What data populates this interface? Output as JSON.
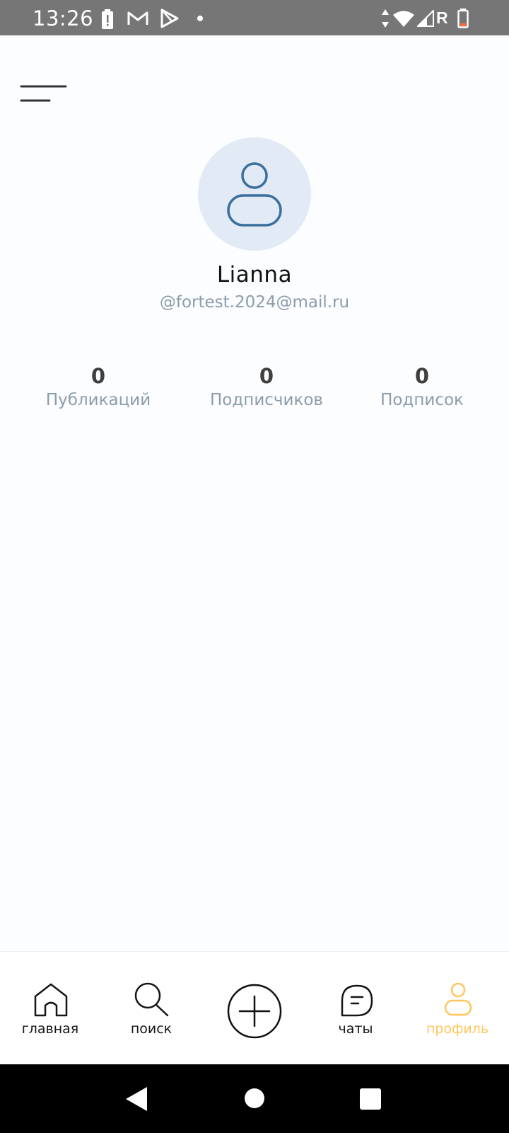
{
  "status_bar": {
    "time": "13:26",
    "icons": [
      "battery-alert-icon",
      "gmail-icon",
      "play-store-icon",
      "dot-icon",
      "data-arrows-icon",
      "wifi-icon",
      "signal-icon",
      "roaming-icon",
      "battery-icon"
    ],
    "roaming_label": "R"
  },
  "profile": {
    "name": "Lianna",
    "handle": "@fortest.2024@mail.ru"
  },
  "stats": [
    {
      "value": "0",
      "label": "Публикаций"
    },
    {
      "value": "0",
      "label": "Подписчиков"
    },
    {
      "value": "0",
      "label": "Подписок"
    }
  ],
  "bottom_nav": {
    "items": [
      {
        "label": "главная",
        "icon": "home-icon"
      },
      {
        "label": "поиск",
        "icon": "search-icon"
      },
      {
        "label": "",
        "icon": "add-circle-icon"
      },
      {
        "label": "чаты",
        "icon": "chat-icon"
      },
      {
        "label": "профиль",
        "icon": "profile-icon",
        "active": true
      }
    ]
  },
  "colors": {
    "accent": "#ffc65c",
    "avatar_bg": "#e2ebf5",
    "avatar_stroke": "#3a6f9e",
    "muted_text": "#8c9cab"
  }
}
